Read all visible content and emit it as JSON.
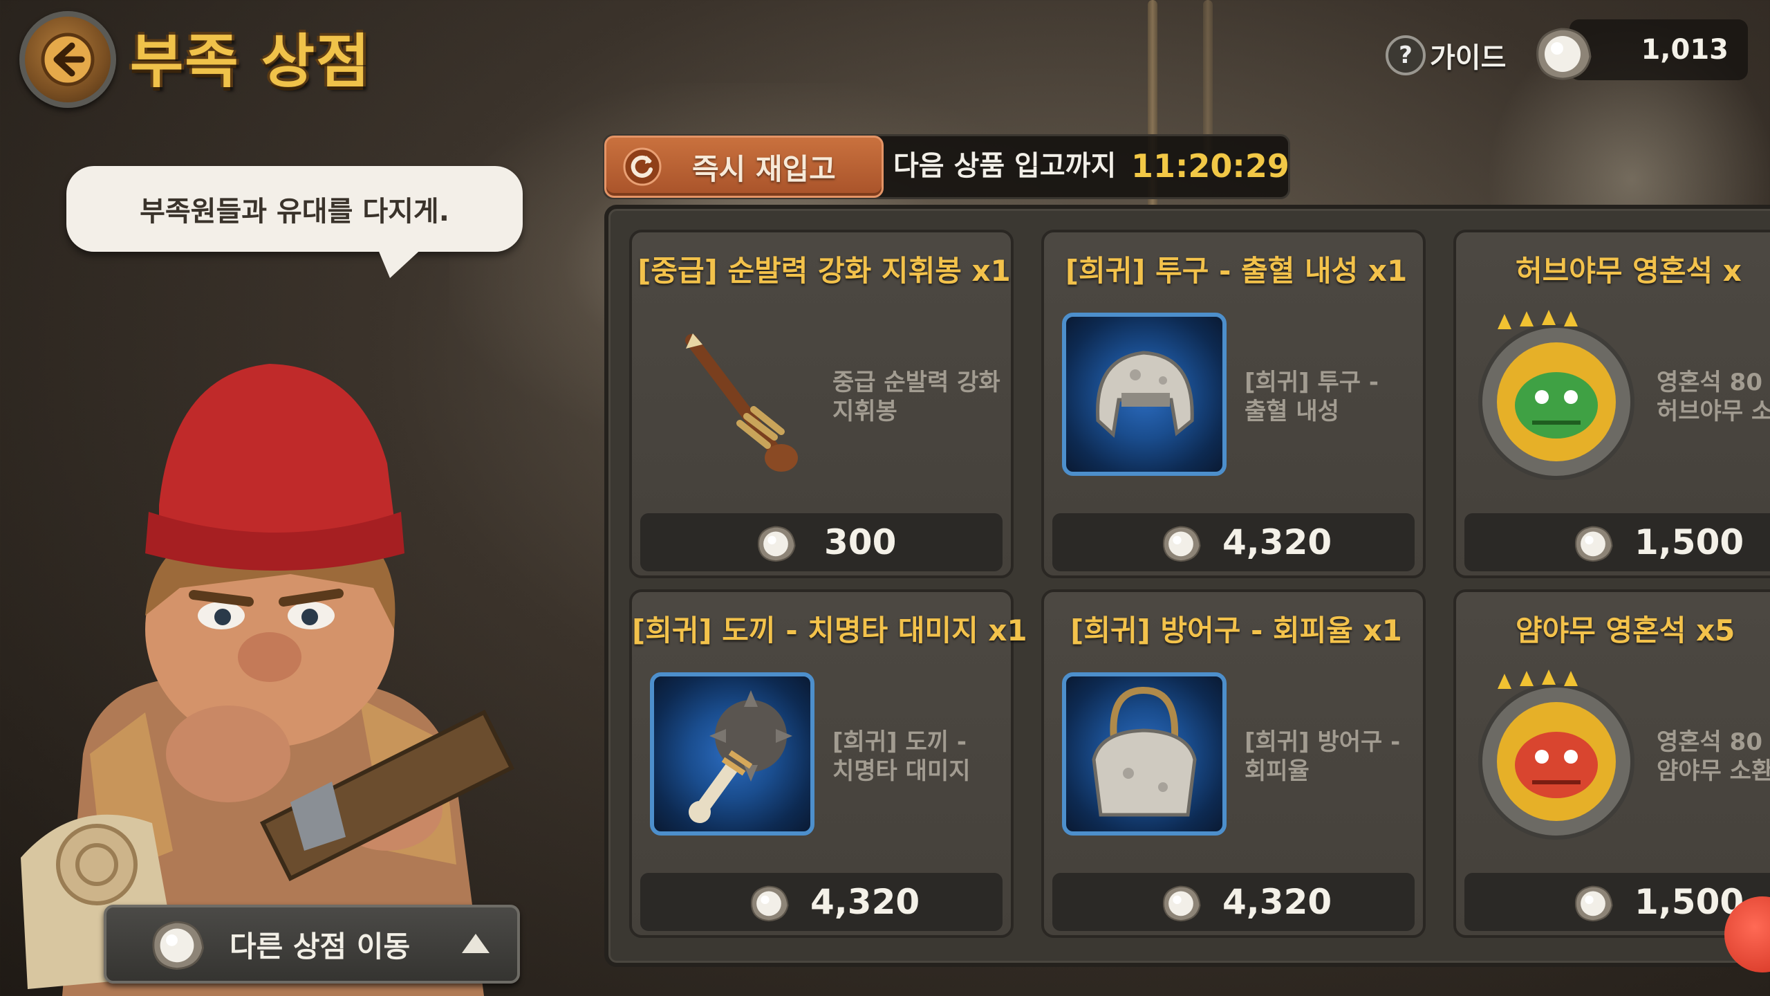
{
  "header": {
    "title": "부족 상점",
    "guide_label": "가이드",
    "guide_icon": "?",
    "currency_value": "1,013"
  },
  "npc": {
    "speech": "부족원들과 유대를 다지게."
  },
  "restock": {
    "button_label": "즉시 재입고",
    "next_label": "다음 상품 입고까지",
    "timer": "11:20:29"
  },
  "bottom": {
    "other_shop_label": "다른 상점 이동"
  },
  "items": [
    {
      "title": "[중급] 순발력 강화 지휘봉 x1",
      "desc": [
        "중급 순발력 강화",
        "지휘봉"
      ],
      "price": "300",
      "icon": "staff-icon"
    },
    {
      "title": "[희귀] 투구 - 출혈 내성 x1",
      "desc": [
        "[희귀] 투구 -",
        "출혈 내성"
      ],
      "price": "4,320",
      "icon": "helmet-icon"
    },
    {
      "title": "허브야무 영혼석 x",
      "desc": [
        "영혼석 80",
        "허브야무 소"
      ],
      "price": "1,500",
      "icon": "soulstone-green-icon"
    },
    {
      "title": "[희귀] 도끼 - 치명타 대미지 x1",
      "desc": [
        "[희귀] 도끼 -",
        "치명타 대미지"
      ],
      "price": "4,320",
      "icon": "axe-icon"
    },
    {
      "title": "[희귀] 방어구 - 회피율 x1",
      "desc": [
        "[희귀] 방어구 -",
        "회피율"
      ],
      "price": "4,320",
      "icon": "armor-icon"
    },
    {
      "title": "얌야무 영혼석 x5",
      "desc": [
        "영혼석 80",
        "얌야무 소환"
      ],
      "price": "1,500",
      "icon": "soulstone-red-icon"
    }
  ],
  "colors": {
    "title_gold": "#f0c24a",
    "item_title": "#f3c24b",
    "restock_button": "#c9713e",
    "timer": "#f2c846",
    "rare_frame": "#4d8fcc"
  }
}
